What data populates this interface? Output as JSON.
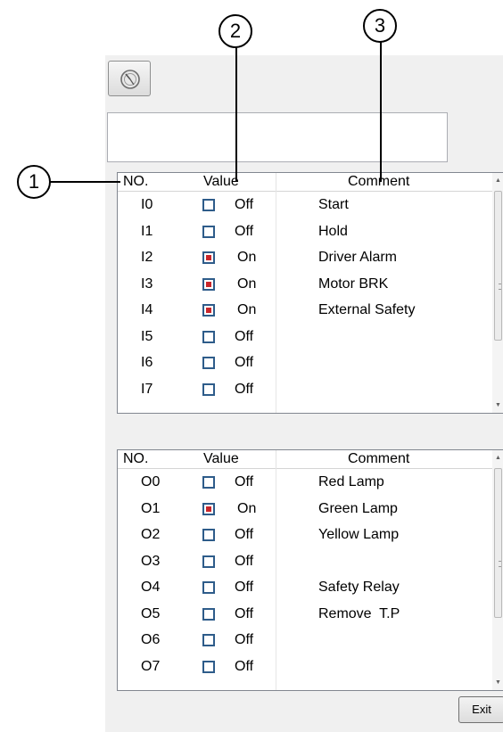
{
  "callouts": [
    "1",
    "2",
    "3"
  ],
  "inputs": {
    "headers": {
      "no": "NO.",
      "value": "Value",
      "comment": "Comment"
    },
    "rows": [
      {
        "no": "I0",
        "state": "Off",
        "on": false,
        "comment": "Start"
      },
      {
        "no": "I1",
        "state": "Off",
        "on": false,
        "comment": "Hold"
      },
      {
        "no": "I2",
        "state": "On",
        "on": true,
        "comment": "Driver Alarm"
      },
      {
        "no": "I3",
        "state": "On",
        "on": true,
        "comment": "Motor BRK"
      },
      {
        "no": "I4",
        "state": "On",
        "on": true,
        "comment": "External Safety"
      },
      {
        "no": "I5",
        "state": "Off",
        "on": false,
        "comment": ""
      },
      {
        "no": "I6",
        "state": "Off",
        "on": false,
        "comment": ""
      },
      {
        "no": "I7",
        "state": "Off",
        "on": false,
        "comment": ""
      }
    ]
  },
  "outputs": {
    "headers": {
      "no": "NO.",
      "value": "Value",
      "comment": "Comment"
    },
    "rows": [
      {
        "no": "O0",
        "state": "Off",
        "on": false,
        "comment": "Red Lamp"
      },
      {
        "no": "O1",
        "state": "On",
        "on": true,
        "comment": "Green Lamp"
      },
      {
        "no": "O2",
        "state": "Off",
        "on": false,
        "comment": "Yellow Lamp"
      },
      {
        "no": "O3",
        "state": "Off",
        "on": false,
        "comment": ""
      },
      {
        "no": "O4",
        "state": "Off",
        "on": false,
        "comment": "Safety Relay"
      },
      {
        "no": "O5",
        "state": "Off",
        "on": false,
        "comment": "Remove  T.P"
      },
      {
        "no": "O6",
        "state": "Off",
        "on": false,
        "comment": ""
      },
      {
        "no": "O7",
        "state": "Off",
        "on": false,
        "comment": ""
      }
    ]
  },
  "textbox": {
    "value": ""
  },
  "exit_label": "Exit",
  "icons": {
    "monitor_button": "gauge-icon",
    "scroll_up": "scroll-up-arrow-icon",
    "scroll_down": "scroll-down-arrow-icon"
  },
  "colors": {
    "on_indicator": "#c8262b",
    "checkbox_border": "#2e5c8a",
    "panel_bg": "#f0f0f0"
  }
}
